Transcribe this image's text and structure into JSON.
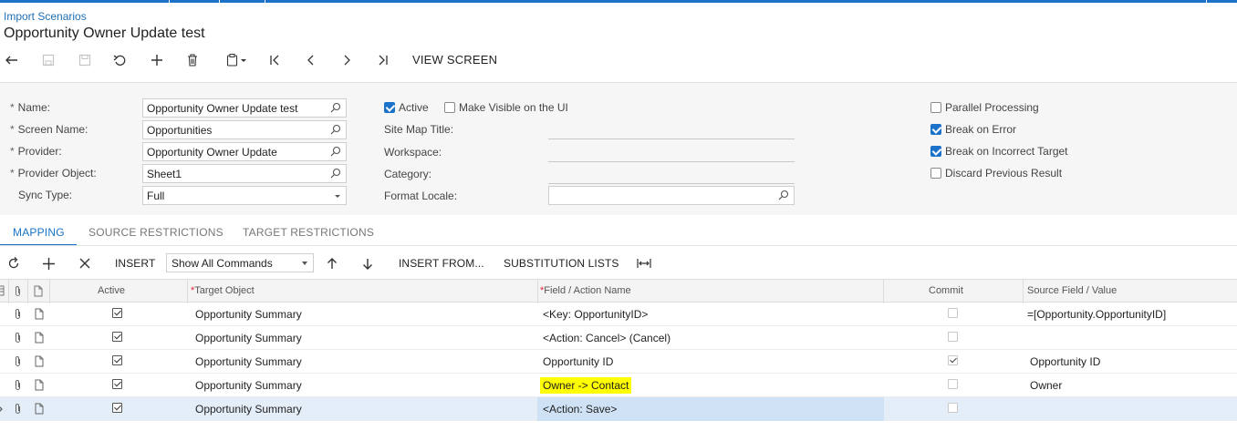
{
  "breadcrumb": "Import Scenarios",
  "title": "Opportunity Owner Update test",
  "toolbar": {
    "view_screen": "VIEW SCREEN"
  },
  "form": {
    "name_label": "Name:",
    "name_value": "Opportunity Owner Update test",
    "screen_name_label": "Screen Name:",
    "screen_name_value": "Opportunities",
    "provider_label": "Provider:",
    "provider_value": "Opportunity Owner Update",
    "provider_object_label": "Provider Object:",
    "provider_object_value": "Sheet1",
    "sync_type_label": "Sync Type:",
    "sync_type_value": "Full",
    "active_label": "Active",
    "active_checked": true,
    "make_visible_label": "Make Visible on the UI",
    "make_visible_checked": false,
    "site_map_title_label": "Site Map Title:",
    "workspace_label": "Workspace:",
    "category_label": "Category:",
    "format_locale_label": "Format Locale:",
    "parallel_processing_label": "Parallel Processing",
    "parallel_processing_checked": false,
    "break_on_error_label": "Break on Error",
    "break_on_error_checked": true,
    "break_on_incorrect_target_label": "Break on Incorrect Target",
    "break_on_incorrect_target_checked": true,
    "discard_previous_result_label": "Discard Previous Result",
    "discard_previous_result_checked": false
  },
  "tabs": [
    "MAPPING",
    "SOURCE RESTRICTIONS",
    "TARGET RESTRICTIONS"
  ],
  "grid_toolbar": {
    "insert": "INSERT",
    "command_filter": "Show All Commands",
    "insert_from": "INSERT FROM...",
    "substitution_lists": "SUBSTITUTION LISTS"
  },
  "grid": {
    "headers": {
      "active": "Active",
      "target_object": "Target Object",
      "field_action": "Field / Action Name",
      "commit": "Commit",
      "source_field": "Source Field / Value"
    },
    "rows": [
      {
        "active": true,
        "target_object": "Opportunity Summary",
        "field": "<Key: OpportunityID>",
        "commit": false,
        "source": "=[Opportunity.OpportunityID]"
      },
      {
        "active": true,
        "target_object": "Opportunity Summary",
        "field": "<Action: Cancel> (Cancel)",
        "commit": false,
        "source": ""
      },
      {
        "active": true,
        "target_object": "Opportunity Summary",
        "field": "Opportunity ID",
        "commit": true,
        "source": "Opportunity ID"
      },
      {
        "active": true,
        "target_object": "Opportunity Summary",
        "field": "Owner -> Contact",
        "commit": false,
        "source": "Owner",
        "highlight": "#ffff00"
      },
      {
        "active": true,
        "target_object": "Opportunity Summary",
        "field": "<Action: Save>",
        "commit": false,
        "source": "",
        "selected": true
      }
    ]
  },
  "colors": {
    "accent": "#1a73c9",
    "highlight": "#ffff00",
    "selected_row": "#e4eef9"
  }
}
